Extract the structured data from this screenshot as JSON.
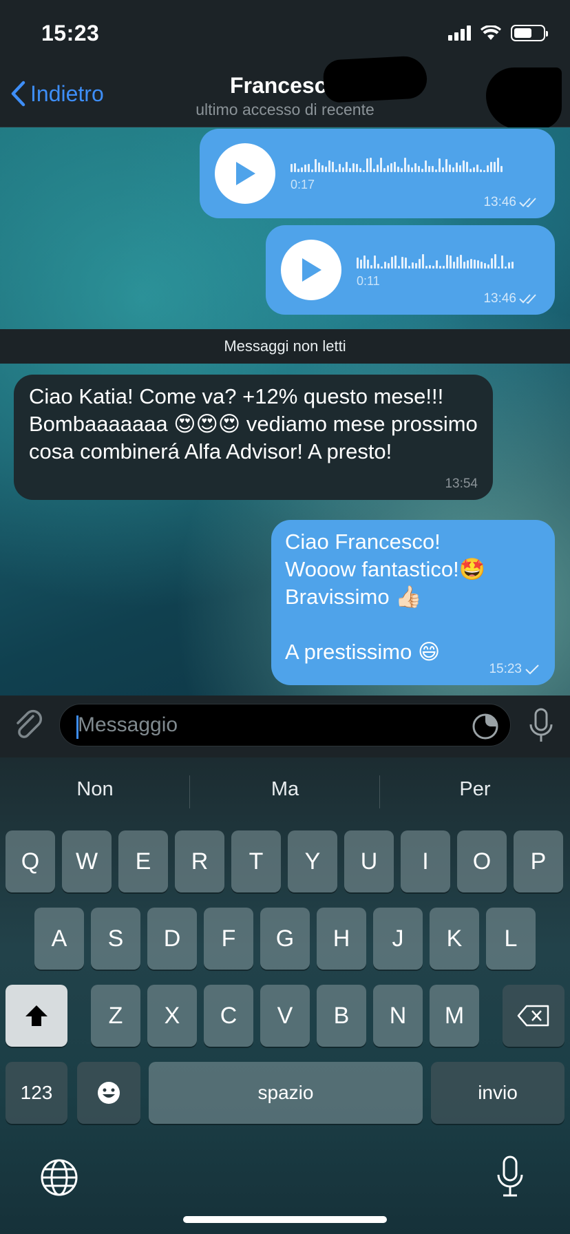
{
  "status_bar": {
    "time": "15:23"
  },
  "header": {
    "back_label": "Indietro",
    "contact_name": "Francesco",
    "contact_status": "ultimo accesso di recente"
  },
  "messages": {
    "voice_1": {
      "duration": "0:17",
      "time": "13:46"
    },
    "voice_2": {
      "duration": "0:11",
      "time": "13:46"
    },
    "unread_divider": "Messaggi non letti",
    "incoming_1": {
      "text": "Ciao Katia! Come va? +12% questo mese!!! Bombaaaaaaa 😍😍😍 vediamo mese prossimo cosa combinerá Alfa Advisor! A presto!",
      "time": "13:54"
    },
    "outgoing_1": {
      "line1": "Ciao Francesco!",
      "line2": "Wooow fantastico!🤩",
      "line3": "Bravissimo 👍🏻",
      "line4": "A prestissimo 😄",
      "time": "15:23"
    }
  },
  "input": {
    "placeholder": "Messaggio"
  },
  "keyboard": {
    "suggestions": [
      "Non",
      "Ma",
      "Per"
    ],
    "row1": [
      "Q",
      "W",
      "E",
      "R",
      "T",
      "Y",
      "U",
      "I",
      "O",
      "P"
    ],
    "row2": [
      "A",
      "S",
      "D",
      "F",
      "G",
      "H",
      "J",
      "K",
      "L"
    ],
    "row3": [
      "Z",
      "X",
      "C",
      "V",
      "B",
      "N",
      "M"
    ],
    "numbers_key": "123",
    "space_key": "spazio",
    "return_key": "invio"
  },
  "colors": {
    "accent": "#3e8ef7",
    "outgoing_bubble": "#4fa3ea",
    "incoming_bubble": "#1d2a2f"
  }
}
